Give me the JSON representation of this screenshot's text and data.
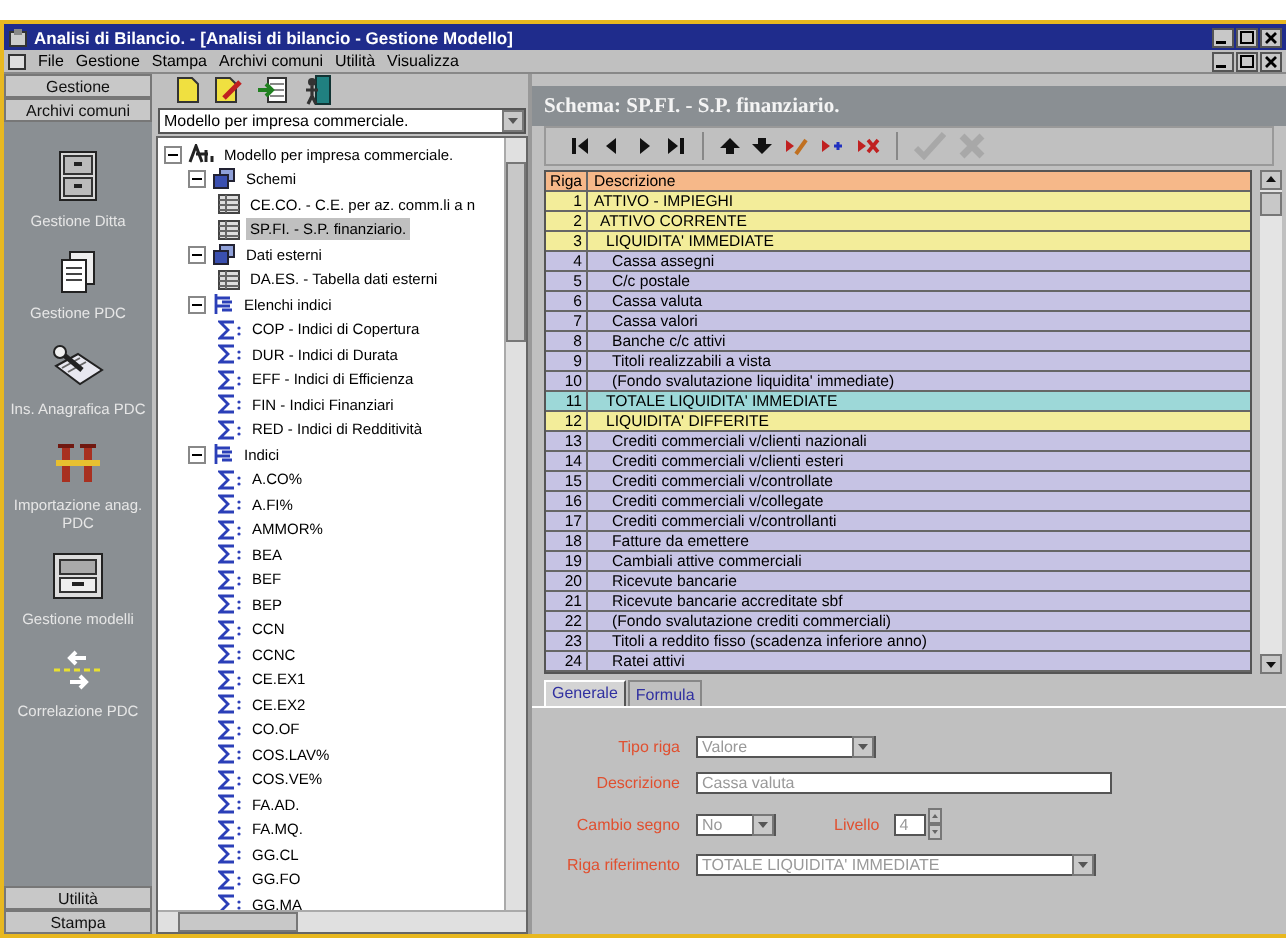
{
  "window": {
    "title": "Analisi di Bilancio. - [Analisi di bilancio - Gestione Modello]"
  },
  "menu": [
    "File",
    "Gestione",
    "Stampa",
    "Archivi comuni",
    "Utilità",
    "Visualizza"
  ],
  "sidebar": {
    "top_buttons": [
      "Gestione",
      "Archivi comuni"
    ],
    "items": [
      "Gestione Ditta",
      "Gestione PDC",
      "Ins. Anagrafica PDC",
      "Importazione anag. PDC",
      "Gestione modelli",
      "Correlazione PDC"
    ],
    "bottom_buttons": [
      "Utilità",
      "Stampa"
    ]
  },
  "model_select": {
    "value": "Modello per impresa commerciale."
  },
  "tree": [
    {
      "label": "Modello per impresa commerciale.",
      "kind": "model",
      "selected": false,
      "expanded": true,
      "children": [
        {
          "label": "Schemi",
          "kind": "folder",
          "selected": false,
          "expanded": true,
          "children": [
            {
              "label": "CE.CO. - C.E. per az. comm.li a n",
              "kind": "table",
              "selected": false
            },
            {
              "label": "SP.FI. - S.P. finanziario.",
              "kind": "table",
              "selected": true
            }
          ]
        },
        {
          "label": "Dati esterni",
          "kind": "folder",
          "selected": false,
          "expanded": true,
          "children": [
            {
              "label": "DA.ES. - Tabella dati esterni",
              "kind": "table",
              "selected": false
            }
          ]
        },
        {
          "label": "Elenchi indici",
          "kind": "list",
          "selected": false,
          "expanded": true,
          "children": [
            {
              "label": "COP - Indici di Copertura",
              "kind": "formula",
              "selected": false
            },
            {
              "label": "DUR - Indici di Durata",
              "kind": "formula",
              "selected": false
            },
            {
              "label": "EFF - Indici di Efficienza",
              "kind": "formula",
              "selected": false
            },
            {
              "label": "FIN - Indici Finanziari",
              "kind": "formula",
              "selected": false
            },
            {
              "label": "RED - Indici di Redditività",
              "kind": "formula",
              "selected": false
            }
          ]
        },
        {
          "label": "Indici",
          "kind": "list",
          "selected": false,
          "expanded": true,
          "children": [
            {
              "label": "A.CO%",
              "kind": "formula",
              "selected": false
            },
            {
              "label": "A.FI%",
              "kind": "formula",
              "selected": false
            },
            {
              "label": "AMMOR%",
              "kind": "formula",
              "selected": false
            },
            {
              "label": "BEA",
              "kind": "formula",
              "selected": false
            },
            {
              "label": "BEF",
              "kind": "formula",
              "selected": false
            },
            {
              "label": "BEP",
              "kind": "formula",
              "selected": false
            },
            {
              "label": "CCN",
              "kind": "formula",
              "selected": false
            },
            {
              "label": "CCNC",
              "kind": "formula",
              "selected": false
            },
            {
              "label": "CE.EX1",
              "kind": "formula",
              "selected": false
            },
            {
              "label": "CE.EX2",
              "kind": "formula",
              "selected": false
            },
            {
              "label": "CO.OF",
              "kind": "formula",
              "selected": false
            },
            {
              "label": "COS.LAV%",
              "kind": "formula",
              "selected": false
            },
            {
              "label": "COS.VE%",
              "kind": "formula",
              "selected": false
            },
            {
              "label": "FA.AD.",
              "kind": "formula",
              "selected": false
            },
            {
              "label": "FA.MQ.",
              "kind": "formula",
              "selected": false
            },
            {
              "label": "GG.CL",
              "kind": "formula",
              "selected": false
            },
            {
              "label": "GG.FO",
              "kind": "formula",
              "selected": false
            },
            {
              "label": "GG.MA",
              "kind": "formula",
              "selected": false
            }
          ]
        }
      ]
    }
  ],
  "schema": {
    "title": "Schema: SP.FI. - S.P. finanziario."
  },
  "grid": {
    "columns": [
      "Riga",
      "Descrizione"
    ],
    "rows": [
      {
        "riga": "1",
        "descrizione": "ATTIVO - IMPIEGHI",
        "kind": "group",
        "children": [
          {
            "riga": "2",
            "descrizione": "ATTIVO CORRENTE",
            "kind": "group",
            "children": [
              {
                "riga": "3",
                "descrizione": "LIQUIDITA' IMMEDIATE",
                "kind": "group",
                "children": [
                  {
                    "riga": "4",
                    "descrizione": "Cassa assegni",
                    "kind": "item"
                  },
                  {
                    "riga": "5",
                    "descrizione": "C/c postale",
                    "kind": "item"
                  },
                  {
                    "riga": "6",
                    "descrizione": "Cassa valuta",
                    "kind": "item"
                  },
                  {
                    "riga": "7",
                    "descrizione": "Cassa valori",
                    "kind": "item"
                  },
                  {
                    "riga": "8",
                    "descrizione": "Banche c/c attivi",
                    "kind": "item"
                  },
                  {
                    "riga": "9",
                    "descrizione": "Titoli realizzabili a vista",
                    "kind": "item"
                  },
                  {
                    "riga": "10",
                    "descrizione": "(Fondo svalutazione liquidita' immediate)",
                    "kind": "item"
                  }
                ]
              },
              {
                "riga": "11",
                "descrizione": "TOTALE LIQUIDITA' IMMEDIATE",
                "kind": "total"
              },
              {
                "riga": "12",
                "descrizione": "LIQUIDITA' DIFFERITE",
                "kind": "group",
                "children": [
                  {
                    "riga": "13",
                    "descrizione": "Crediti commerciali v/clienti nazionali",
                    "kind": "item"
                  },
                  {
                    "riga": "14",
                    "descrizione": "Crediti commerciali v/clienti esteri",
                    "kind": "item"
                  },
                  {
                    "riga": "15",
                    "descrizione": "Crediti commerciali v/controllate",
                    "kind": "item"
                  },
                  {
                    "riga": "16",
                    "descrizione": "Crediti commerciali v/collegate",
                    "kind": "item"
                  },
                  {
                    "riga": "17",
                    "descrizione": "Crediti commerciali v/controllanti",
                    "kind": "item"
                  },
                  {
                    "riga": "18",
                    "descrizione": "Fatture da emettere",
                    "kind": "item"
                  },
                  {
                    "riga": "19",
                    "descrizione": "Cambiali attive commerciali",
                    "kind": "item"
                  },
                  {
                    "riga": "20",
                    "descrizione": "Ricevute bancarie",
                    "kind": "item"
                  },
                  {
                    "riga": "21",
                    "descrizione": "Ricevute bancarie accreditate sbf",
                    "kind": "item"
                  },
                  {
                    "riga": "22",
                    "descrizione": "(Fondo svalutazione crediti commerciali)",
                    "kind": "item"
                  },
                  {
                    "riga": "23",
                    "descrizione": "Titoli a reddito fisso (scadenza inferiore anno)",
                    "kind": "item"
                  },
                  {
                    "riga": "24",
                    "descrizione": "Ratei attivi",
                    "kind": "item"
                  }
                ]
              }
            ]
          }
        ]
      }
    ]
  },
  "form_tabs": [
    {
      "label": "Generale",
      "selected": true
    },
    {
      "label": "Formula",
      "selected": false
    }
  ],
  "form": {
    "tipo_riga": {
      "label": "Tipo riga",
      "value": "Valore",
      "disabled": true
    },
    "descrizione": {
      "label": "Descrizione",
      "value": "Cassa valuta",
      "disabled": true
    },
    "cambio_segno": {
      "label": "Cambio segno",
      "value": "No",
      "disabled": true
    },
    "livello": {
      "label": "Livello",
      "value": "4",
      "disabled": true
    },
    "riga_riferimento": {
      "label": "Riga riferimento",
      "value": "TOTALE LIQUIDITA' IMMEDIATE",
      "disabled": true
    }
  }
}
